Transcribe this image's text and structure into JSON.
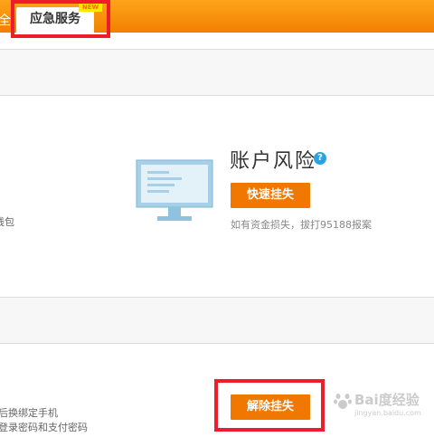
{
  "topbar": {
    "cut_tab_label": "全",
    "active_tab_label": "应急服务",
    "new_badge": "NEW"
  },
  "account_section": {
    "left_cut_text": "钱包",
    "risk_title": "账户风险",
    "help_icon": "?",
    "report_button_label": "快速挂失",
    "hint_text": "如有资金损失，拔打95188报案"
  },
  "unfreeze_section": {
    "left_cut_line1": "后换绑定手机",
    "left_cut_line2": "登录密码和支付密码",
    "unfreeze_button_label": "解除挂失"
  },
  "watermark": {
    "title": "Bai度经验",
    "url": "jingyan.baidu.com"
  },
  "colors": {
    "orange": "#f07800",
    "highlight_red": "#ee1c2d",
    "help_blue": "#2aa3e0"
  }
}
